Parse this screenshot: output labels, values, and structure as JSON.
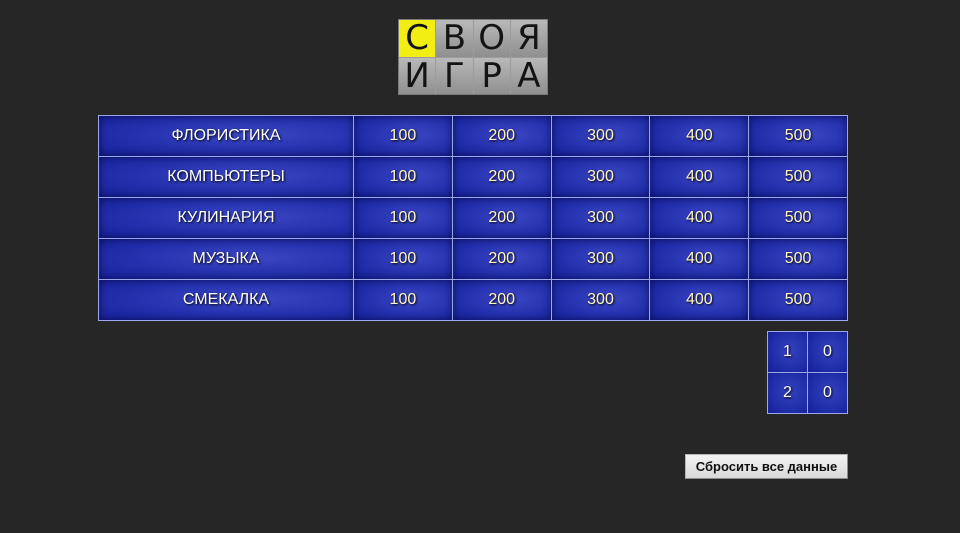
{
  "logo": {
    "cells": [
      "С",
      "В",
      "О",
      "Я",
      "И",
      "Г",
      "Р",
      "А"
    ],
    "highlight_color": "#f2ee13"
  },
  "board": {
    "categories": [
      {
        "name": "ФЛОРИСТИКА",
        "prices": [
          "100",
          "200",
          "300",
          "400",
          "500"
        ]
      },
      {
        "name": "КОМПЬЮТЕРЫ",
        "prices": [
          "100",
          "200",
          "300",
          "400",
          "500"
        ]
      },
      {
        "name": "КУЛИНАРИЯ",
        "prices": [
          "100",
          "200",
          "300",
          "400",
          "500"
        ]
      },
      {
        "name": "МУЗЫКА",
        "prices": [
          "100",
          "200",
          "300",
          "400",
          "500"
        ]
      },
      {
        "name": "СМЕКАЛКА",
        "prices": [
          "100",
          "200",
          "300",
          "400",
          "500"
        ]
      }
    ]
  },
  "score": {
    "rows": [
      {
        "player": "1",
        "points": "0"
      },
      {
        "player": "2",
        "points": "0"
      }
    ]
  },
  "reset_button": {
    "label": "Сбросить все данные"
  },
  "colors": {
    "background": "#262626",
    "cell_blue": "#2430ad",
    "cell_border": "#9aa8e8",
    "price_text": "#fff6c2"
  }
}
